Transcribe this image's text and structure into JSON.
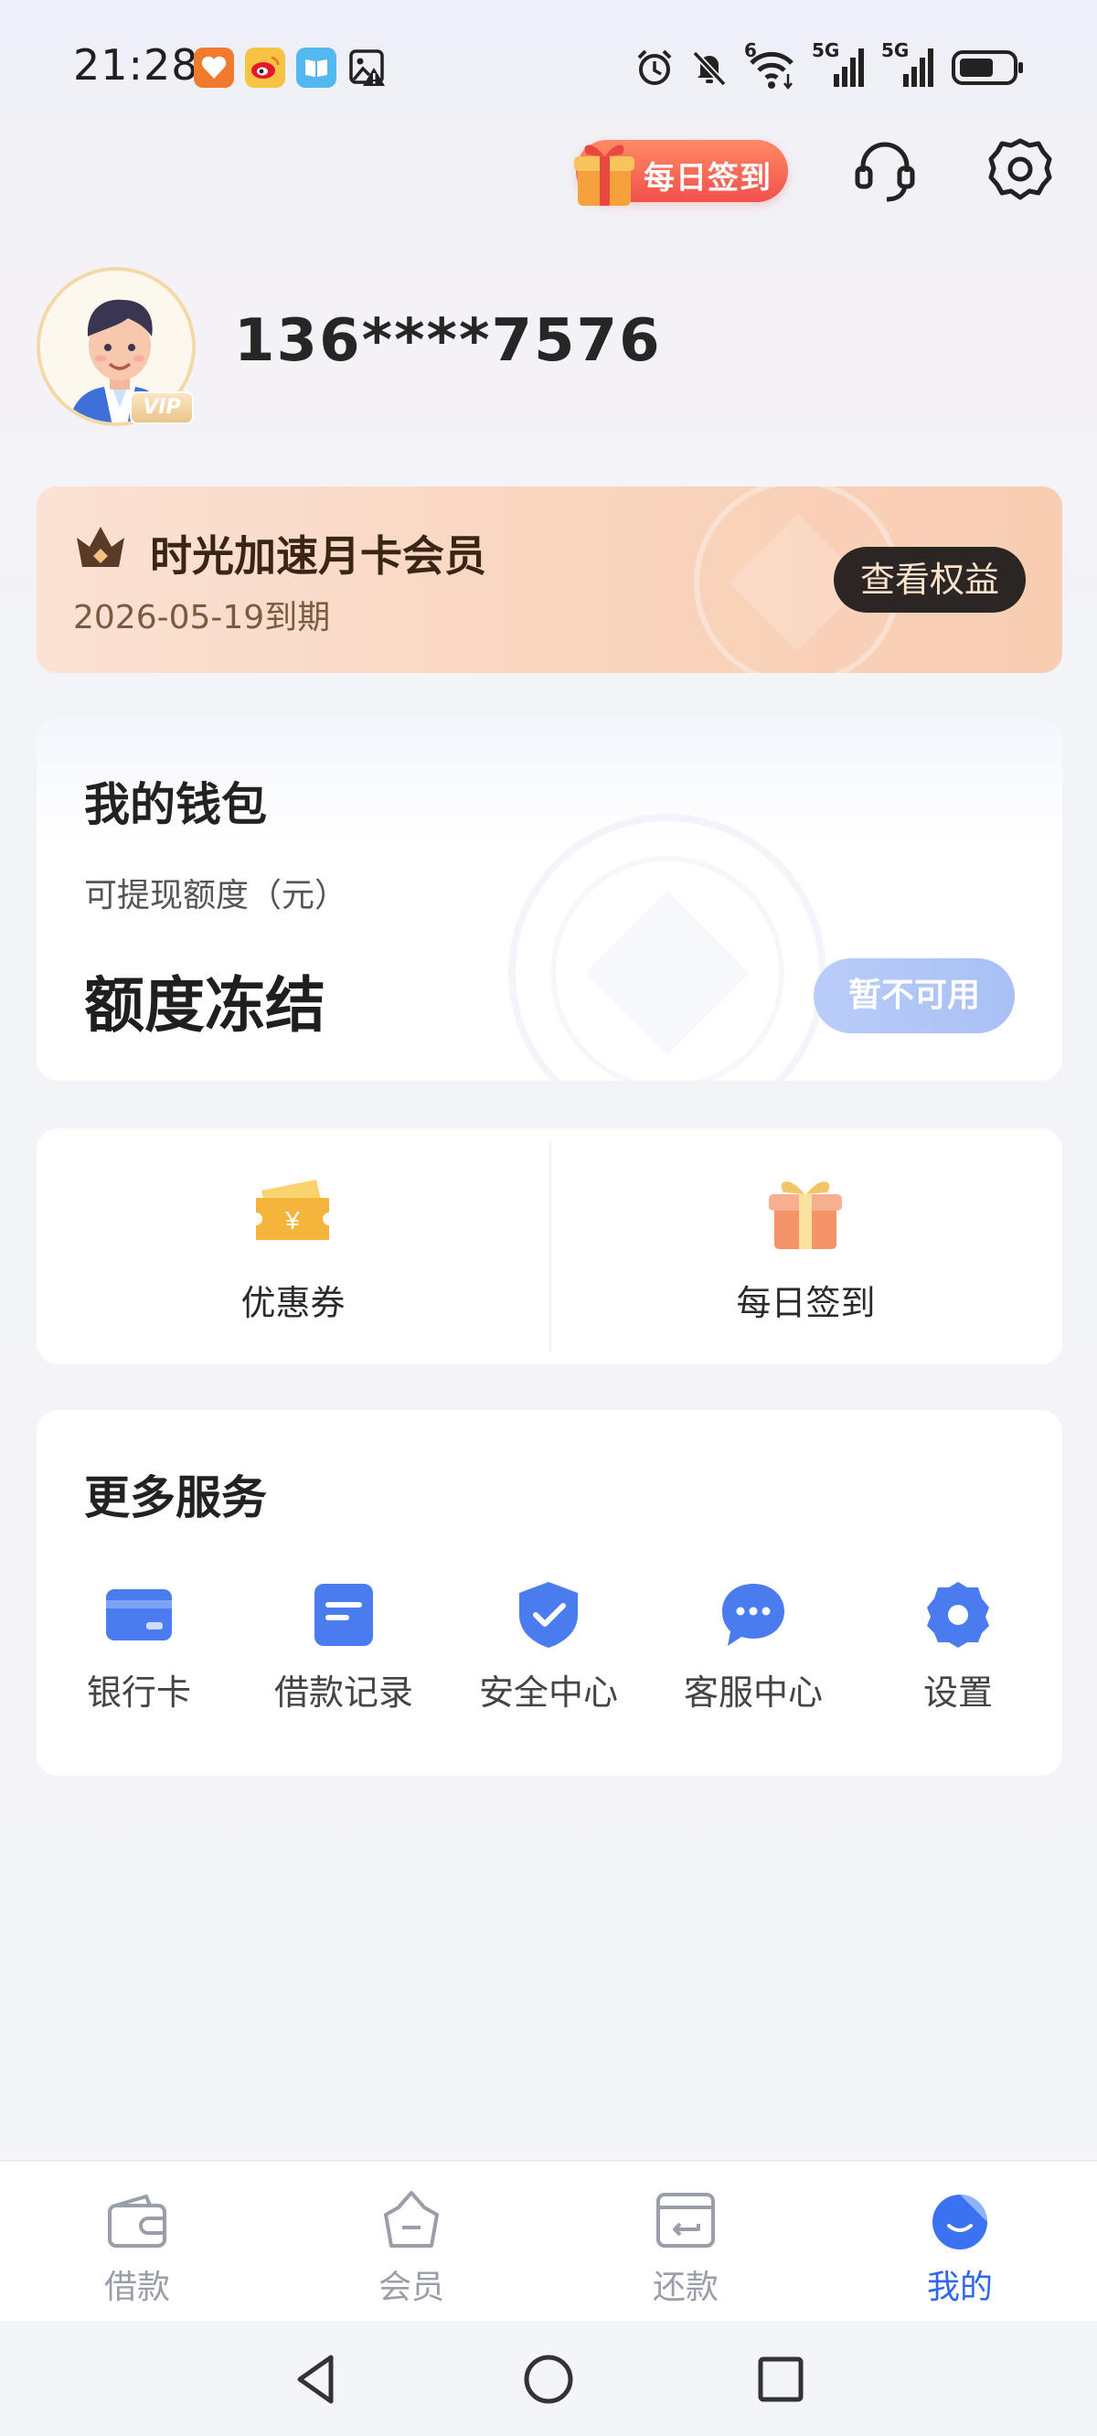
{
  "status_bar": {
    "time": "21:28",
    "icons": [
      "health-app-icon",
      "weibo-icon",
      "reader-icon",
      "gallery-warning-icon",
      "alarm-icon",
      "mute-icon",
      "wifi-icon",
      "signal-5g-icon",
      "signal-5g-icon",
      "battery-icon"
    ],
    "signal_1_label": "5G",
    "signal_2_label": "5G",
    "wifi_label": "6"
  },
  "header": {
    "checkin_label": "每日签到",
    "icons": [
      "customer-service-icon",
      "settings-gear-icon"
    ]
  },
  "profile": {
    "phone": "136****7576",
    "vip_badge": "VIP"
  },
  "membership": {
    "title": "时光加速月卡会员",
    "expire": "2026-05-19到期",
    "button_label": "查看权益"
  },
  "wallet": {
    "title": "我的钱包",
    "subtitle": "可提现额度（元）",
    "value": "额度冻结",
    "button_label": "暂不可用"
  },
  "quick_entries": [
    {
      "label": "优惠券",
      "icon": "coupon-icon"
    },
    {
      "label": "每日签到",
      "icon": "gift-icon"
    }
  ],
  "services": {
    "title": "更多服务",
    "items": [
      {
        "label": "银行卡",
        "icon": "bank-card-icon"
      },
      {
        "label": "借款记录",
        "icon": "loan-record-icon"
      },
      {
        "label": "安全中心",
        "icon": "security-shield-icon"
      },
      {
        "label": "客服中心",
        "icon": "chat-bubble-icon"
      },
      {
        "label": "设置",
        "icon": "settings-icon"
      }
    ]
  },
  "tabbar": {
    "tabs": [
      {
        "label": "借款",
        "icon": "wallet-icon",
        "active": false
      },
      {
        "label": "会员",
        "icon": "crown-basket-icon",
        "active": false
      },
      {
        "label": "还款",
        "icon": "repay-icon",
        "active": false
      },
      {
        "label": "我的",
        "icon": "profile-smile-icon",
        "active": true
      }
    ]
  },
  "colors": {
    "accent_blue": "#2f67f0",
    "service_icon_blue": "#4a7cf0",
    "member_card_bg": "#f9d3bc",
    "checkin_red": "#f2504c"
  }
}
